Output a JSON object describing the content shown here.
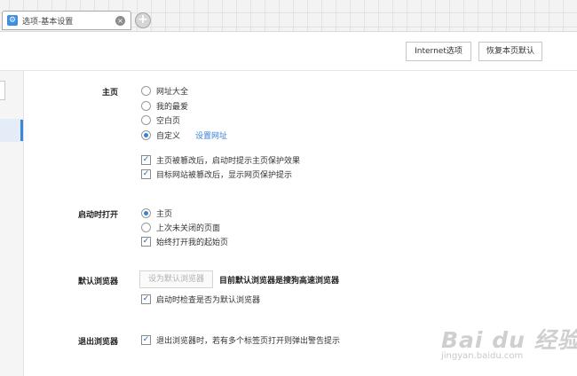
{
  "tab": {
    "icon": "settings-gear-icon",
    "title": "选项-基本设置",
    "close_glyph": "×",
    "new_tab_glyph": "+"
  },
  "toolbar": {
    "internet_options": "Internet选项",
    "restore_default": "恢复本页默认"
  },
  "sections": {
    "homepage": {
      "label": "主页",
      "options": [
        "网址大全",
        "我的最爱",
        "空白页",
        "自定义"
      ],
      "selected": "自定义",
      "set_url_link": "设置网址",
      "checks": [
        "主页被篡改后，启动时提示主页保护效果",
        "目标网站被篡改后，显示网页保护提示"
      ]
    },
    "startup": {
      "label": "启动时打开",
      "options": [
        "主页",
        "上次未关闭的页面"
      ],
      "selected": "主页",
      "check": "始终打开我的起始页"
    },
    "default_browser": {
      "label": "默认浏览器",
      "set_default_button": "设为默认浏览器",
      "current_status": "目前默认浏览器是搜狗高速浏览器",
      "check": "启动时检查是否为默认浏览器"
    },
    "exit_browser": {
      "label": "退出浏览器",
      "check": "退出浏览器时，若有多个标签页打开则弹出警告提示"
    }
  },
  "watermark": {
    "main": "Bai du 经验",
    "sub": "jingyan.baidu.com"
  },
  "colors": {
    "accent": "#3b82d6",
    "link": "#3b82d6",
    "border": "#c6c6c6"
  }
}
